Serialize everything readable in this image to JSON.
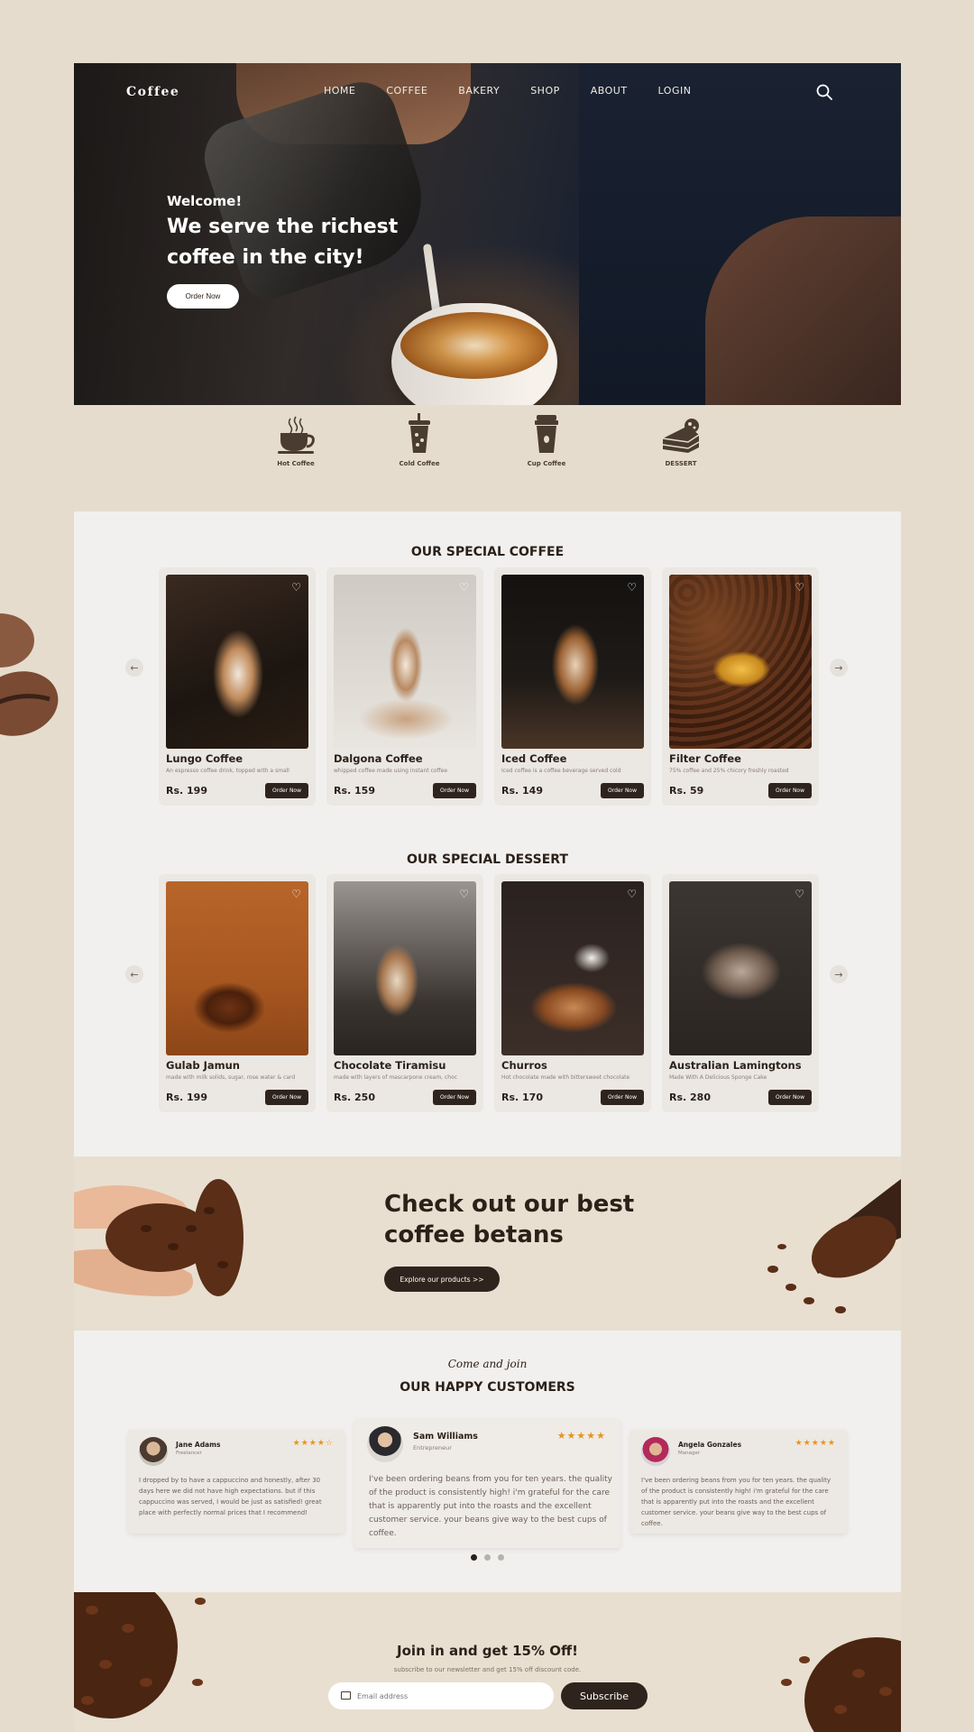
{
  "header": {
    "logo": "Coffee",
    "nav": [
      "HOME",
      "COFFEE",
      "BAKERY",
      "SHOP",
      "ABOUT",
      "LOGIN"
    ]
  },
  "hero": {
    "welcome": "Welcome!",
    "headline": "We serve the richest coffee in the city!",
    "button": "Order Now"
  },
  "categories": [
    "Hot Coffee",
    "Cold Coffee",
    "Cup Coffee",
    "DESSERT"
  ],
  "coffee_section": {
    "title": "OUR SPECIAL COFFEE",
    "items": [
      {
        "name": "Lungo Coffee",
        "desc": "An espresso coffee drink, topped with a small",
        "price": "Rs. 199",
        "button": "Order Now"
      },
      {
        "name": "Dalgona Coffee",
        "desc": "whipped coffee made using instant coffee",
        "price": "Rs. 159",
        "button": "Order Now"
      },
      {
        "name": "Iced Coffee",
        "desc": "Iced coffee is a coffee beverage served cold",
        "price": "Rs. 149",
        "button": "Order Now"
      },
      {
        "name": "Filter Coffee",
        "desc": "75% coffee and 25% chicory freshly roasted",
        "price": "Rs. 59",
        "button": "Order Now"
      }
    ]
  },
  "dessert_section": {
    "title": "OUR SPECIAL DESSERT",
    "items": [
      {
        "name": "Gulab Jamun",
        "desc": "made with milk solids, sugar, rose water & card",
        "price": "Rs. 199",
        "button": "Order Now"
      },
      {
        "name": "Chocolate Tiramisu",
        "desc": "made with layers of mascarpone cream, choc",
        "price": "Rs. 250",
        "button": "Order Now"
      },
      {
        "name": "Churros",
        "desc": "Hot chocolate made with bittersweet chocolate",
        "price": "Rs. 170",
        "button": "Order Now"
      },
      {
        "name": "Australian Lamingtons",
        "desc": "Made With A Delicious Sponge Cake",
        "price": "Rs. 280",
        "button": "Order Now"
      }
    ]
  },
  "beans_banner": {
    "headline": "Check out our best coffee betans",
    "button": "Explore our products >>"
  },
  "testimonials": {
    "kicker": "Come and join",
    "title": "OUR HAPPY CUSTOMERS",
    "items": [
      {
        "name": "Jane Adams",
        "role": "Freelancer",
        "stars": "★★★★☆",
        "text": "I dropped by to have a cappuccino and honestly, after 30 days here we did not have high expectations. but if this cappuccino was served, I would be just as satisfied! great place with perfectly normal prices that I recommend!"
      },
      {
        "name": "Sam Williams",
        "role": "Entrepreneur",
        "stars": "★★★★★",
        "text": "I've been ordering beans from you for ten years. the quality of the product is consistently high! i'm grateful for the care that is apparently put into the roasts and the excellent customer service. your beans give way to the best cups of coffee."
      },
      {
        "name": "Angela Gonzales",
        "role": "Manager",
        "stars": "★★★★★",
        "text": "I've been ordering beans from you for ten years. the quality of the product is consistently high! i'm grateful for the care that is apparently put into the roasts and the excellent customer service. your beans give way to the best cups of coffee."
      }
    ]
  },
  "newsletter": {
    "title": "Join in and get 15% Off!",
    "subtitle": "subscribe to our newsletter and get 15% off discount code.",
    "placeholder": "Email address",
    "button": "Subscribe"
  },
  "colors": {
    "accent": "#2f241d",
    "background": "#e6dccd",
    "panel": "#f2f0ee",
    "star": "#e7951e"
  }
}
